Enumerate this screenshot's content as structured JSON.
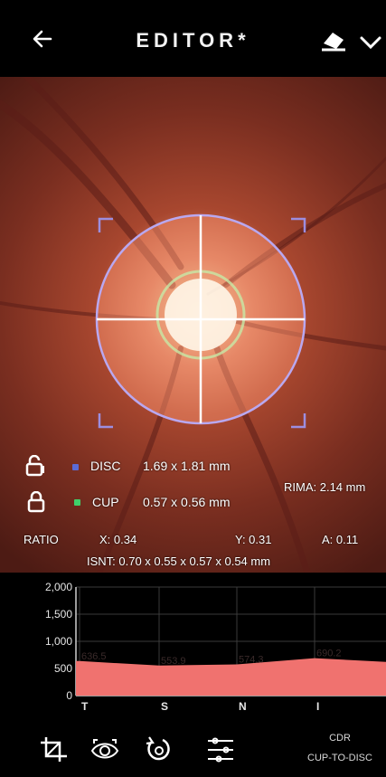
{
  "header": {
    "title": "EDITOR*",
    "back_icon": "arrow-left-icon",
    "eraser_icon": "eraser-icon",
    "chevron_icon": "chevron-down-icon"
  },
  "measurements": {
    "disc_label": "DISC",
    "disc_value": "1.69 x 1.81 mm",
    "cup_label": "CUP",
    "cup_value": "0.57 x 0.56 mm",
    "rima": "RIMA: 2.14 mm",
    "ratio_label": "RATIO",
    "ratio_x": "X: 0.34",
    "ratio_y": "Y: 0.31",
    "ratio_a": "A: 0.11",
    "isnt": "ISNT: 0.70 x 0.55 x 0.57 x 0.54 mm",
    "disc_color": "#5b6bd6",
    "cup_color": "#3fd06a"
  },
  "chart_data": {
    "type": "area",
    "categories": [
      "T",
      "S",
      "N",
      "I"
    ],
    "values": [
      636.5,
      553.9,
      574.3,
      690.2
    ],
    "data_labels": [
      "636.5",
      "553.9",
      "574.3",
      "690.2"
    ],
    "y_ticks": [
      "2,000",
      "1,500",
      "1,000",
      "500",
      "0"
    ],
    "ylim": [
      0,
      2000
    ],
    "grid": true,
    "fill_color": "#f0726f"
  },
  "toolbar": {
    "crop_icon": "crop-icon",
    "eye_icon": "eye-scan-icon",
    "rotate_icon": "rotate-icon",
    "sliders_icon": "sliders-icon",
    "cdr_line1": "CDR",
    "cdr_line2": "CUP-TO-DISC"
  }
}
